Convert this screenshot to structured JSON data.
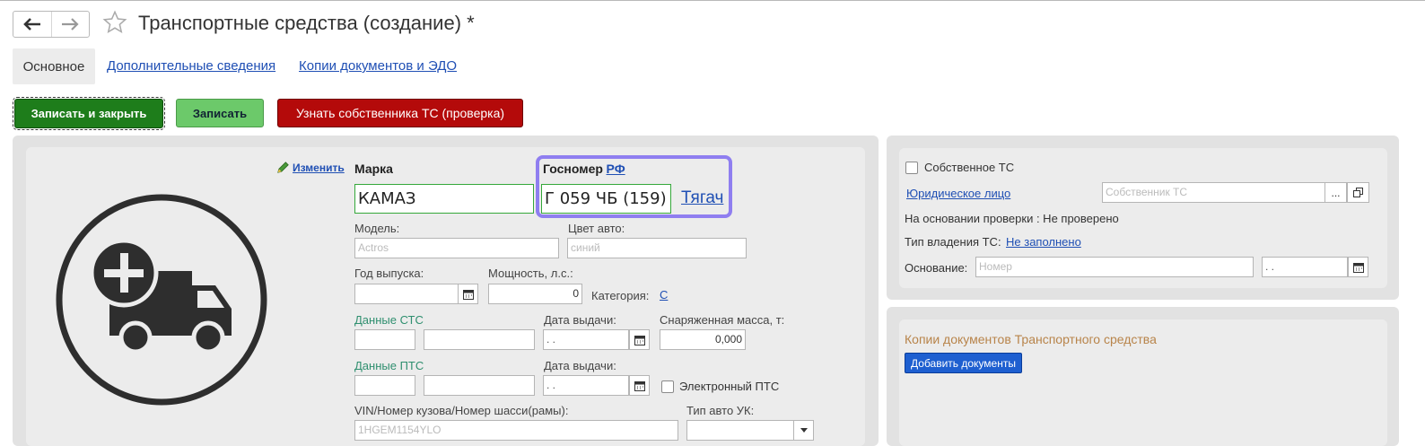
{
  "window": {
    "title": "Транспортные средства (создание) *"
  },
  "nav": {
    "back_icon": "arrow-left-icon",
    "forward_icon": "arrow-right-icon",
    "favorite_icon": "star-icon"
  },
  "tabs": [
    {
      "label": "Основное",
      "active": true
    },
    {
      "label": "Дополнительные сведения"
    },
    {
      "label": "Копии документов и ЭДО"
    }
  ],
  "toolbar": {
    "save_close": "Записать и закрыть",
    "save": "Записать",
    "owner_check": "Узнать собственника ТС (проверка)"
  },
  "left": {
    "edit_link": "Изменить",
    "brand_label": "Марка",
    "brand_value": "КАМАЗ",
    "plate_label": "Госномер",
    "plate_country": "РФ",
    "plate_value": "Г 059 ЧБ (159)",
    "plate_type": "Тягач",
    "model_label": "Модель:",
    "model_placeholder": "Actros",
    "color_label": "Цвет авто:",
    "color_placeholder": "синий",
    "year_label": "Год выпуска:",
    "year_value": "",
    "power_label": "Мощность, л.с.:",
    "power_value": "0",
    "category_label": "Категория:",
    "category_value": "С",
    "sts_label": "Данные СТС",
    "sts_date_label": "Дата выдачи:",
    "sts_date_value": " .  .",
    "mass_label": "Снаряженная масса, т:",
    "mass_value": "0,000",
    "pts_label": "Данные ПТС",
    "pts_date_label": "Дата выдачи:",
    "pts_date_value": " .  .",
    "epts_label": "Электронный ПТС",
    "vin_label": "VIN/Номер кузова/Номер шасси(рамы):",
    "vin_placeholder": "1HGEM1154YLO",
    "type_label": "Тип авто УК:",
    "type_value": ""
  },
  "right_top": {
    "own_label": "Собственное ТС",
    "legal_link": "Юридическое лицо",
    "owner_placeholder": "Собственник ТС",
    "ellipsis": "...",
    "check_text": "На основании проверки : Не проверено",
    "ownership_label": "Тип владения ТС:",
    "ownership_value": "Не заполнено",
    "basis_label": "Основание:",
    "basis_placeholder": "Номер",
    "basis_date": " .  ."
  },
  "right_bottom": {
    "title": "Копии документов Транспортного средства",
    "add_button": "Добавить документы"
  },
  "colors": {
    "accent_green": "#1e7d1b",
    "light_green": "#6cc96a",
    "red": "#b40a0a",
    "link_blue": "#1f4fb4",
    "highlight": "#8f7ef0",
    "section_orange": "#b8844a"
  }
}
